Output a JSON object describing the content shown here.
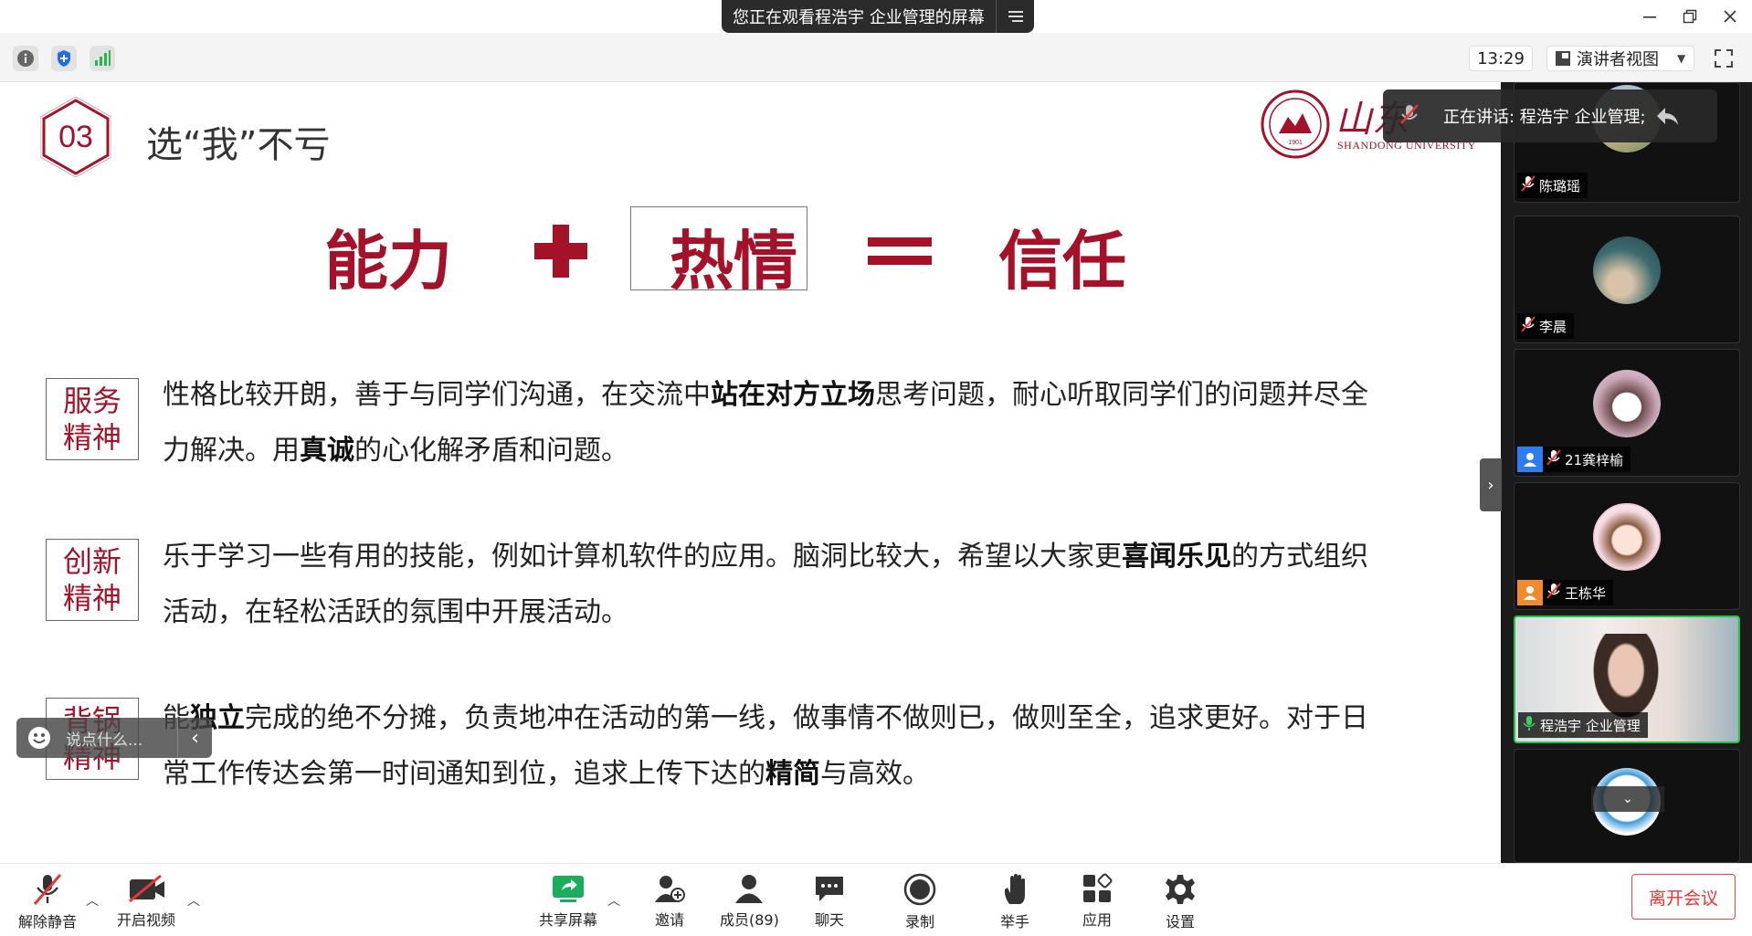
{
  "titlebar": {
    "share_banner": "您正在观看程浩宇 企业管理的屏幕",
    "menu_icon": "menu-lines-icon",
    "minimize": "minimize-icon",
    "restore": "restore-icon",
    "close": "close-icon"
  },
  "topbar": {
    "icons": [
      "info-icon",
      "shield-icon",
      "signal-bars-icon"
    ],
    "time": "13:29",
    "view_mode": "演讲者视图",
    "fullscreen_icon": "fullscreen-icon"
  },
  "slide": {
    "section_number": "03",
    "title": "选“我”不亏",
    "university_name": "SHANDONG UNIVERSITY",
    "university_cn": "山东",
    "equation": {
      "left": "能力",
      "middle": "热情",
      "right": "信任",
      "plus_icon": "plus-icon",
      "equals_icon": "equals-icon"
    },
    "rows": [
      {
        "label_line1": "服务",
        "label_line2": "精神",
        "text_a": "性格比较开朗，善于与同学们沟通，在交流中",
        "bold_a": "站在对方立场",
        "text_b": "思考问题，耐心听取同学们的问题并尽全力解决。用",
        "bold_b": "真诚",
        "text_c": "的心化解矛盾和问题。"
      },
      {
        "label_line1": "创新",
        "label_line2": "精神",
        "text_a": "乐于学习一些有用的技能，例如计算机软件的应用。脑洞比较大，希望以大家更",
        "bold_a": "喜闻乐见",
        "text_b": "的方式组织活动，在轻松活跃的氛围中开展活动。",
        "bold_b": "",
        "text_c": ""
      },
      {
        "label_line1": "背锅",
        "label_line2": "精神",
        "text_a": "能",
        "bold_a": "独立",
        "text_b": "完成的绝不分摊，负责地冲在活动的第一线，做事情不做则已，做则至全，追求更好。对于日常工作传达会第一时间通知到位，追求上传下达的",
        "bold_b": "精简",
        "text_c": "与高效。"
      }
    ]
  },
  "comment_box": {
    "placeholder": "说点什么...",
    "icon": "smile-icon",
    "arrow": "‹"
  },
  "speaking": {
    "text": "正在讲话: 程浩宇 企业管理;",
    "mic_icon": "mic-muted-icon",
    "share_icon": "share-arrow-icon"
  },
  "collapse_arrow": "›",
  "participants": [
    {
      "name": "陈璐瑶",
      "muted": true,
      "avatar": "landscape"
    },
    {
      "name": "李晨",
      "muted": true,
      "avatar": "hands"
    },
    {
      "name": "21龚梓榆",
      "muted": true,
      "avatar": "cartoon"
    },
    {
      "name": "王栋华",
      "muted": true,
      "avatar": "sdu-girl"
    },
    {
      "name": "程浩宇 企业管理",
      "muted": false,
      "avatar": "video",
      "active": true
    },
    {
      "name": "",
      "muted": true,
      "avatar": "sketch"
    }
  ],
  "bottombar": {
    "unmute": "解除静音",
    "start_video": "开启视频",
    "share_screen": "共享屏幕",
    "invite": "邀请",
    "members": "成员(89)",
    "chat": "聊天",
    "record": "录制",
    "raise_hand": "举手",
    "apps": "应用",
    "settings": "设置",
    "leave": "离开会议"
  },
  "colors": {
    "accent_red": "#a4122a",
    "share_green": "#1aad5b",
    "leave_red": "#e33333"
  }
}
